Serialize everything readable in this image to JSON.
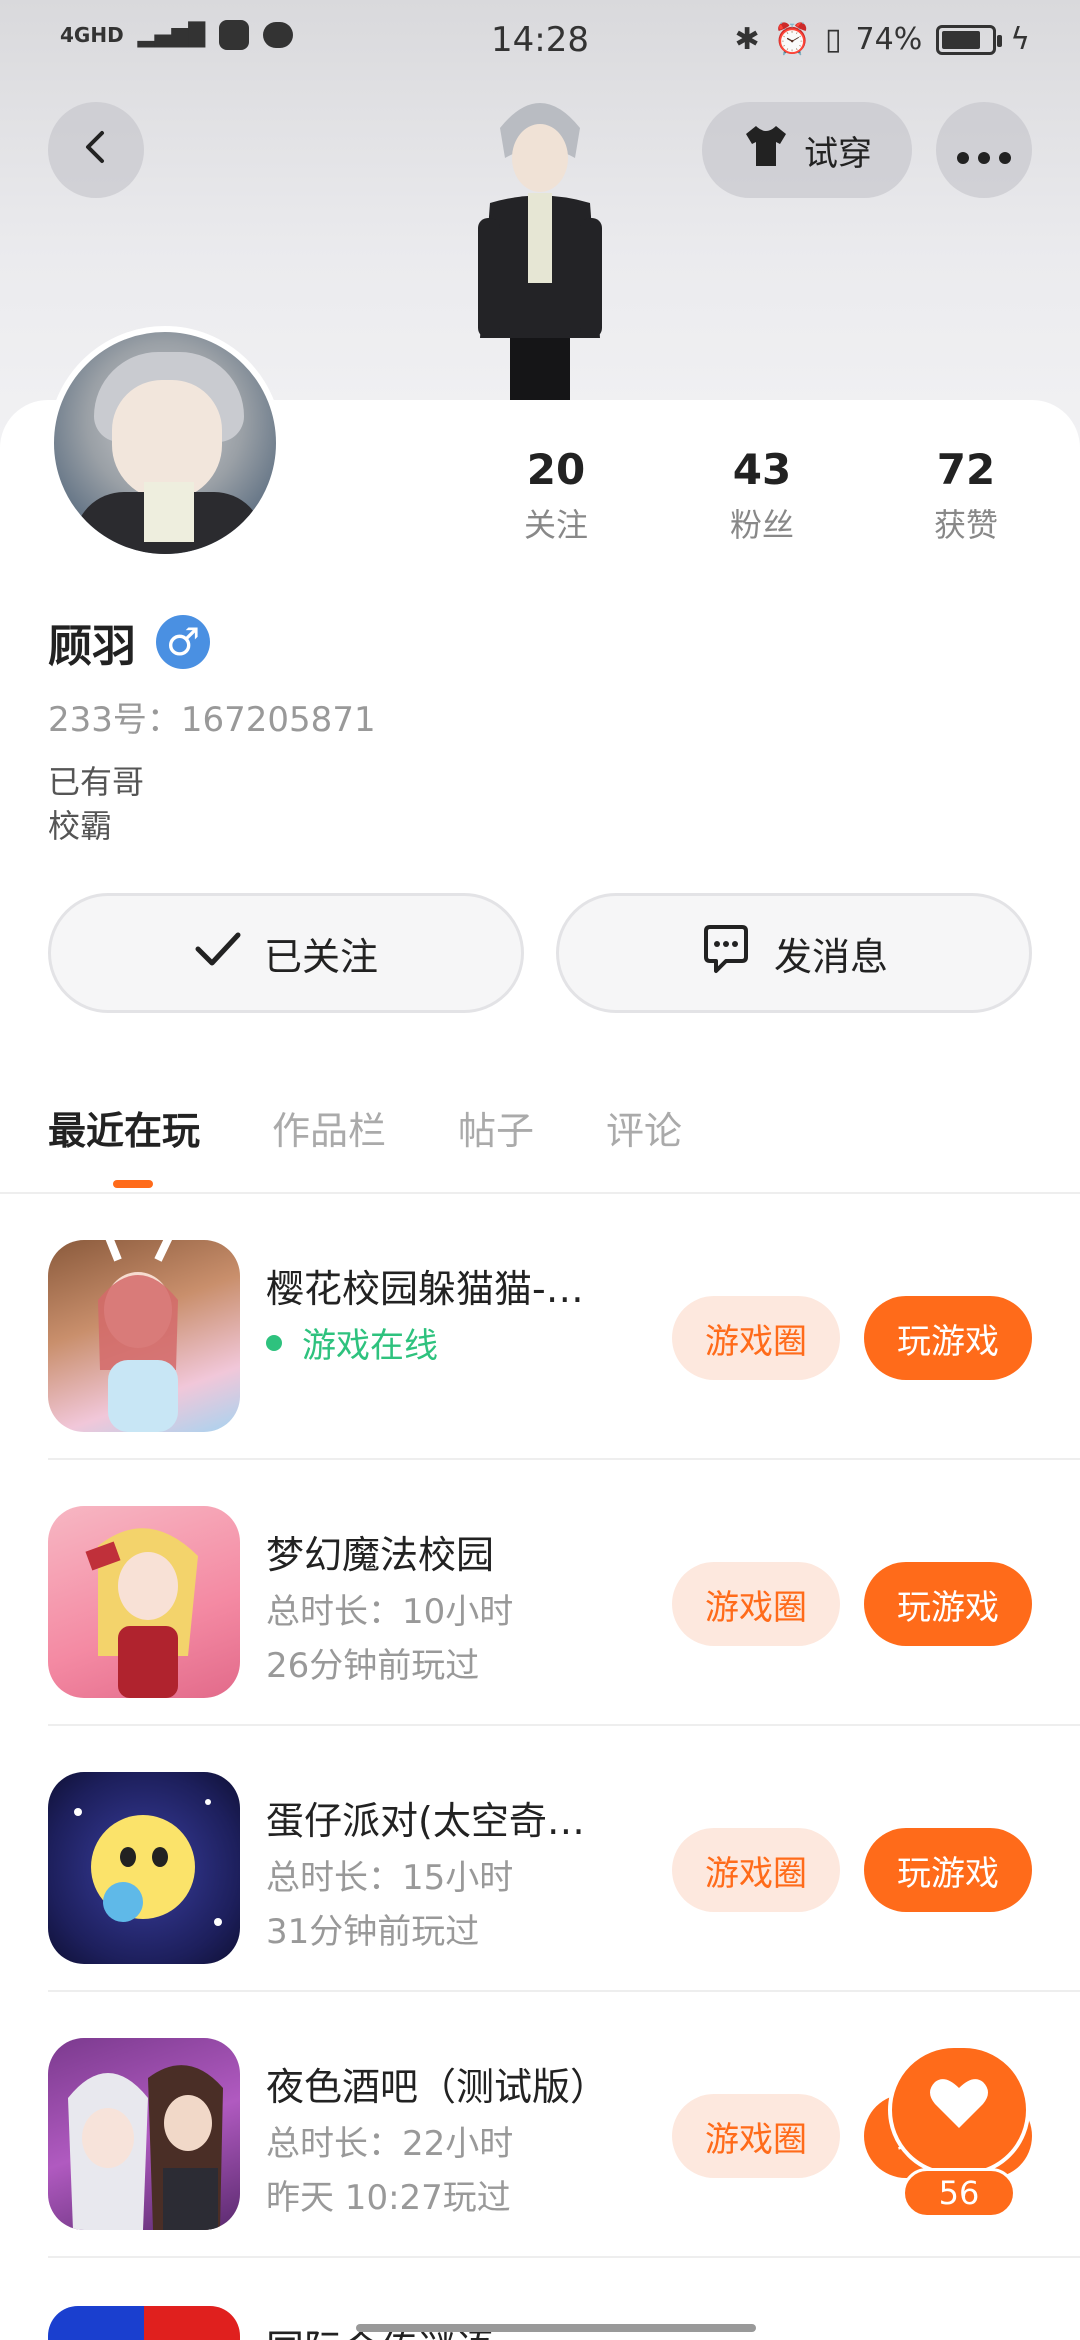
{
  "status_bar": {
    "network": "4GHD",
    "time": "14:28",
    "battery": "74%"
  },
  "header": {
    "back_icon": "chevron-left-icon",
    "tryon_label": "试穿",
    "more_icon": "more-horizontal-icon"
  },
  "profile": {
    "name": "顾羽",
    "gender_symbol": "♂",
    "uid": "233号：167205871",
    "bio_lines": [
      "已有哥",
      "校霸"
    ],
    "stats": [
      {
        "num": "20",
        "label": "关注"
      },
      {
        "num": "43",
        "label": "粉丝"
      },
      {
        "num": "72",
        "label": "获赞"
      }
    ]
  },
  "actions": {
    "follow_label": "已关注",
    "message_label": "发消息"
  },
  "tabs": [
    {
      "label": "最近在玩",
      "active": true
    },
    {
      "label": "作品栏",
      "active": false
    },
    {
      "label": "帖子",
      "active": false
    },
    {
      "label": "评论",
      "active": false
    }
  ],
  "games": [
    {
      "title": "樱花校园躲猫猫-…",
      "online": "游戏在线",
      "circle_btn": "游戏圈",
      "play_btn": "玩游戏"
    },
    {
      "title": "梦幻魔法校园",
      "duration": "总时长：10小时",
      "last_played": "26分钟前玩过",
      "circle_btn": "游戏圈",
      "play_btn": "玩游戏"
    },
    {
      "title": "蛋仔派对(太空奇…",
      "duration": "总时长：15小时",
      "last_played": "31分钟前玩过",
      "circle_btn": "游戏圈",
      "play_btn": "玩游戏"
    },
    {
      "title": "夜色酒吧（测试版）",
      "duration": "总时长：22小时",
      "last_played": "昨天 10:27玩过",
      "circle_btn": "游戏圈",
      "play_btn": "玩游戏"
    }
  ],
  "next_game_title": "国际会传谜语",
  "like_fab": {
    "count": "56",
    "icon": "heart-icon"
  },
  "colors": {
    "accent": "#ff6b1a",
    "online": "#2ec27e",
    "gender": "#4a90e2"
  }
}
